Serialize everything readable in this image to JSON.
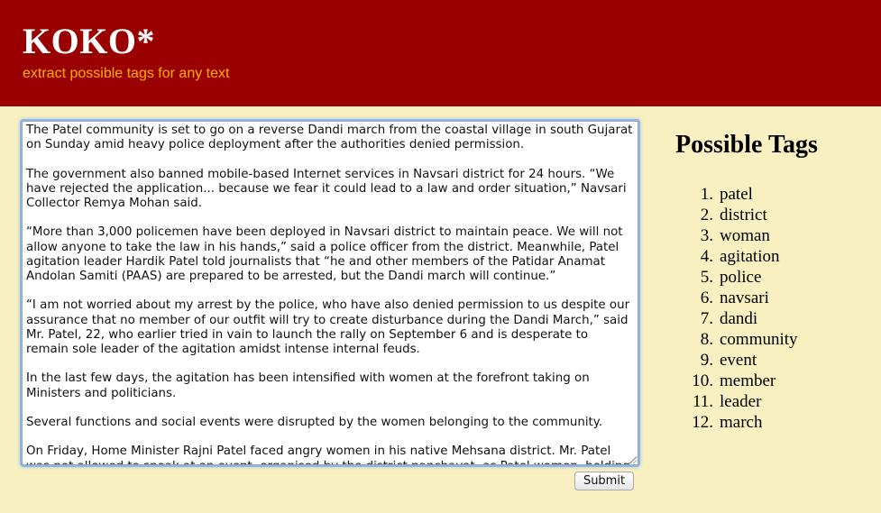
{
  "header": {
    "logo": "KOKO*",
    "tagline": "extract possible tags for any text"
  },
  "input": {
    "text": "The Patel community is set to go on a reverse Dandi march from the coastal village in south Gujarat on Sunday amid heavy police deployment after the authorities denied permission.\n\nThe government also banned mobile-based Internet services in Navsari district for 24 hours. “We have rejected the application... because we fear it could lead to a law and order situation,” Navsari Collector Remya Mohan said.\n\n“More than 3,000 policemen have been deployed in Navsari district to maintain peace. We will not allow anyone to take the law in his hands,” said a police officer from the district. Meanwhile, Patel agitation leader Hardik Patel told journalists that “he and other members of the Patidar Anamat Andolan Samiti (PAAS) are prepared to be arrested, but the Dandi march will continue.”\n\n“I am not worried about my arrest by the police, who have also denied permission to us despite our assurance that no member of our outfit will try to create disturbance during the Dandi March,” said Mr. Patel, 22, who earlier tried in vain to launch the rally on September 6 and is desperate to remain sole leader of the agitation amidst intense internal feuds.\n\nIn the last few days, the agitation has been intensified with women at the forefront taking on Ministers and politicians.\n\nSeveral functions and social events were disrupted by the women belonging to the community.\n\nOn Friday, Home Minister Rajni Patel faced angry women in his native Mehsana district. Mr. Patel was not allowed to speak at an event, organised by the district panchayat, as Patel women, holding"
  },
  "submit_label": "Submit",
  "tags": {
    "title": "Possible Tags",
    "items": [
      {
        "num": "1.",
        "tag": "patel"
      },
      {
        "num": "2.",
        "tag": "district"
      },
      {
        "num": "3.",
        "tag": "woman"
      },
      {
        "num": "4.",
        "tag": "agitation"
      },
      {
        "num": "5.",
        "tag": "police"
      },
      {
        "num": "6.",
        "tag": "navsari"
      },
      {
        "num": "7.",
        "tag": "dandi"
      },
      {
        "num": "8.",
        "tag": "community"
      },
      {
        "num": "9.",
        "tag": "event"
      },
      {
        "num": "10.",
        "tag": "member"
      },
      {
        "num": "11.",
        "tag": "leader"
      },
      {
        "num": "12.",
        "tag": "march"
      }
    ]
  },
  "colors": {
    "header_bg": "#9a0000",
    "page_bg": "#f8f0c0",
    "tagline": "#ffb000",
    "logo": "#ffffff"
  }
}
